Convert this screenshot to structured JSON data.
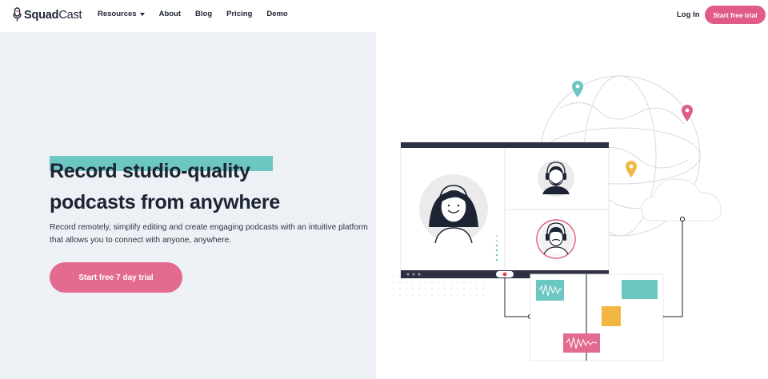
{
  "brand": {
    "name_bold": "Squad",
    "name_light": "Cast"
  },
  "nav": {
    "items": [
      {
        "label": "Resources",
        "has_caret": true
      },
      {
        "label": "About"
      },
      {
        "label": "Blog"
      },
      {
        "label": "Pricing"
      },
      {
        "label": "Demo"
      }
    ],
    "login_label": "Log In",
    "cta_label": "Start free trial"
  },
  "hero": {
    "headline_line1": "Record studio-quality",
    "headline_line2": "podcasts from anywhere",
    "subtext": "Record remotely, simplify editing and create engaging podcasts with an intuitive platform that allows you to connect with anyone, anywhere.",
    "cta_label": "Start free 7 day trial"
  },
  "colors": {
    "accent_pink": "#e05c86",
    "accent_teal": "#6cc6c1",
    "accent_yellow": "#f2b742",
    "dark_navy": "#1c2333",
    "hero_bg": "#edf0f4"
  }
}
